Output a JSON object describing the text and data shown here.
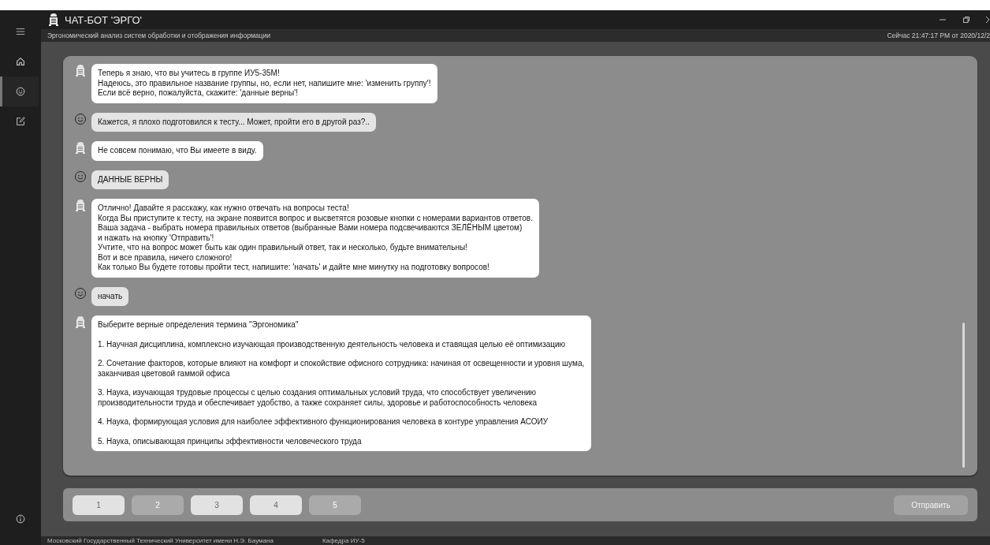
{
  "window": {
    "title": "ЧАТ-БОТ 'ЭРГО'",
    "subtitle": "Эргономический анализ систем обработки и отображения информации",
    "clock": "Сейчас 21:47:17 PM от 2020/12/2"
  },
  "sidebar": {
    "items": [
      {
        "kind": "home",
        "selected": false
      },
      {
        "kind": "chat",
        "selected": true
      },
      {
        "kind": "edit",
        "selected": false
      }
    ]
  },
  "messages": [
    {
      "kind": "bot",
      "paragraphs": [
        [
          "Теперь я знаю, что вы учитесь в группе ИУ5-35М!",
          "Надеюсь, это правильное название группы, но, если нет, напишите мне: 'изменить группу'!",
          "Если всё верно, пожалуйста, скажите: 'данные верны'!"
        ]
      ]
    },
    {
      "kind": "user",
      "paragraphs": [
        [
          "Кажется, я плохо подготовился к тесту... Может, пройти его в другой раз?.."
        ]
      ]
    },
    {
      "kind": "bot",
      "paragraphs": [
        [
          "Не совсем понимаю, что Вы имеете в виду."
        ]
      ]
    },
    {
      "kind": "user",
      "paragraphs": [
        [
          "ДАННЫЕ ВЕРНЫ"
        ]
      ]
    },
    {
      "kind": "bot",
      "paragraphs": [
        [
          "Отлично! Давайте я расскажу, как нужно отвечать на вопросы теста!",
          "Когда Вы приступите к тесту, на экране появится вопрос и высветятся розовые кнопки с номерами вариантов ответов.",
          "Ваша задача - выбрать номера правильных ответов (выбранные Вами номера подсвечиваются ЗЕЛЁНЫМ цветом)",
          "и нажать на кнопку 'Отправить'!",
          "Учтите, что на вопрос может быть как один правильный ответ, так и несколько, будьте внимательны!",
          "Вот и все правила, ничего сложного!",
          "Как только Вы будете готовы пройти тест, напишите: 'начать' и дайте мне минутку на подготовку вопросов!"
        ]
      ]
    },
    {
      "kind": "user",
      "paragraphs": [
        [
          "начать"
        ]
      ]
    },
    {
      "kind": "bot",
      "paragraphs": [
        [
          "Выберите верные определения термина \"Эргономика\""
        ],
        [
          "1. Научная дисциплина, комплексно изучающая производственную деятельность человека и ставящая целью её оптимизацию"
        ],
        [
          "2. Сочетание факторов, которые влияют на комфорт и спокойствие офисного сотрудника: начиная от освещенности и уровня шума, заканчивая цветовой гаммой офиса"
        ],
        [
          "3. Наука, изучающая трудовые процессы с целью создания оптимальных условий труда, что способствует увеличению производительности труда и обеспечивает удобство, а также сохраняет силы, здоровье и работоспособность человека"
        ],
        [
          "4. Наука, формирующая условия для наиболее эффективного функционирования человека в контуре управления АСОИУ"
        ],
        [
          "5. Наука, описывающая принципы эффективности человеческого труда"
        ]
      ]
    }
  ],
  "answers": [
    {
      "label": "1",
      "selected": true
    },
    {
      "label": "2",
      "selected": false
    },
    {
      "label": "3",
      "selected": true
    },
    {
      "label": "4",
      "selected": true
    },
    {
      "label": "5",
      "selected": false
    }
  ],
  "send_button": {
    "label": "Отправить"
  },
  "footer": {
    "university": "Московский Государственный Технический Университет имени Н.Э. Баумана",
    "department": "Кафедра ИУ-5"
  }
}
